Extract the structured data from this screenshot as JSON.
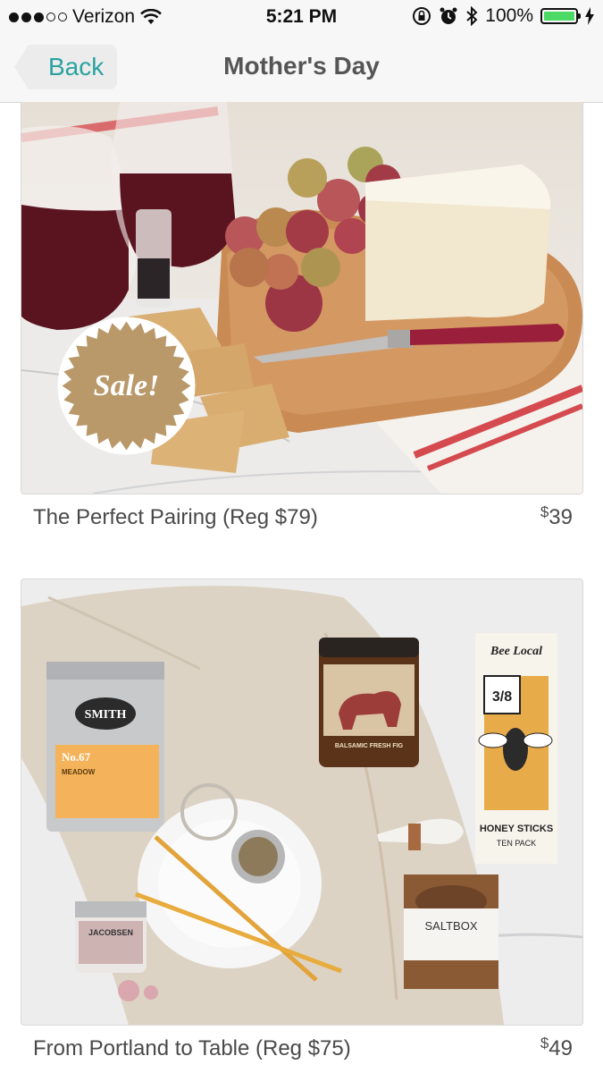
{
  "status_bar": {
    "carrier": "Verizon",
    "time": "5:21 PM",
    "battery_pct": "100%",
    "signal_bars_filled": 3,
    "signal_bars_total": 5
  },
  "nav": {
    "back_label": "Back",
    "title": "Mother's Day"
  },
  "products": [
    {
      "name": "The Perfect Pairing (Reg $79)",
      "currency": "$",
      "price": "39",
      "badge": "Sale!"
    },
    {
      "name": "From Portland to Table (Reg $75)",
      "currency": "$",
      "price": "49",
      "labels": {
        "tea_brand": "SMITH",
        "tea_number": "No.67",
        "tea_name": "MEADOW",
        "jam": "BALSAMIC FRESH FIG",
        "honey_brand": "Bee Local",
        "honey_fraction": "3/8",
        "honey_product": "HONEY STICKS",
        "honey_pack": "TEN PACK",
        "salt_brand": "JACOBSEN",
        "saltbox": "SALTBOX"
      }
    }
  ],
  "colors": {
    "accent": "#2aa3a0",
    "badge": "#b99869",
    "battery": "#4cd964"
  }
}
